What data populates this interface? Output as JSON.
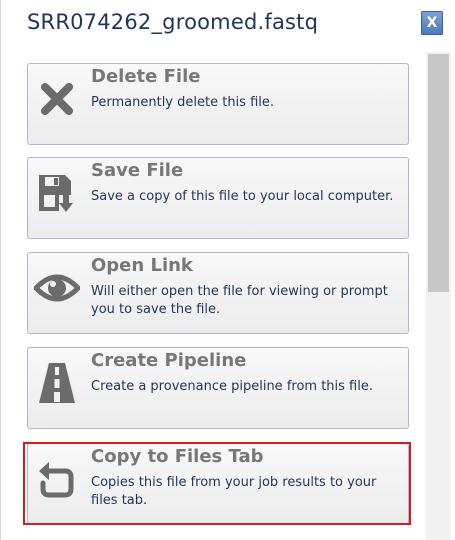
{
  "header": {
    "title": "SRR074262_groomed.fastq",
    "close_label": "X"
  },
  "menu": {
    "items": [
      {
        "label": "Delete File",
        "description": "Permanently delete this file.",
        "icon": "delete-x-icon"
      },
      {
        "label": "Save File",
        "description": "Save a copy of this file to your local computer.",
        "icon": "save-disk-icon"
      },
      {
        "label": "Open Link",
        "description": "Will either open the file for viewing or prompt you to save the file.",
        "icon": "eye-icon"
      },
      {
        "label": "Create Pipeline",
        "description": "Create a provenance pipeline from this file.",
        "icon": "road-icon"
      },
      {
        "label": "Copy to Files Tab",
        "description": "Copies this file from your job results to your files tab.",
        "icon": "copy-arrow-icon"
      }
    ]
  },
  "colors": {
    "title": "#1f3558",
    "label": "#777777",
    "description": "#1f3558",
    "item_border": "#b7b3d8",
    "highlight_border": "#d11f1f",
    "close_button": "#4c79c2"
  }
}
